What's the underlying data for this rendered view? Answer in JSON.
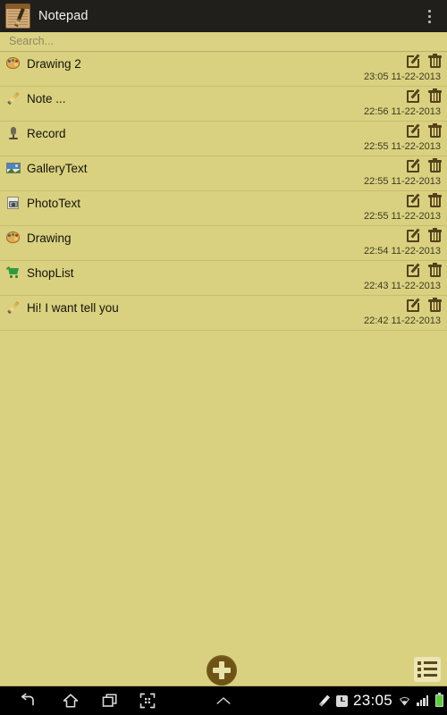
{
  "titlebar": {
    "app_name": "Notepad",
    "app_icon": "notepad-pencil-icon",
    "overflow_icon": "overflow-menu-icon",
    "background": "#211f1c",
    "text_color": "#f2f2ef"
  },
  "search": {
    "placeholder": "Search...",
    "value": ""
  },
  "theme": {
    "page_background": "#d9d17f",
    "row_divider": "#c6bd72",
    "action_icon_color": "#55401c",
    "accent": "#6e5317"
  },
  "notes": [
    {
      "icon": "palette-icon",
      "title": "Drawing 2",
      "date": "23:05 11-22-2013"
    },
    {
      "icon": "pencil-icon",
      "title": "Note ...",
      "date": "22:56 11-22-2013"
    },
    {
      "icon": "mic-icon",
      "title": "Record",
      "date": "22:55 11-22-2013"
    },
    {
      "icon": "gallery-icon",
      "title": "GalleryText",
      "date": "22:55 11-22-2013"
    },
    {
      "icon": "camera-icon",
      "title": "PhotoText",
      "date": "22:55 11-22-2013"
    },
    {
      "icon": "palette-icon",
      "title": "Drawing",
      "date": "22:54 11-22-2013"
    },
    {
      "icon": "cart-icon",
      "title": "ShopList",
      "date": "22:43 11-22-2013"
    },
    {
      "icon": "pencil-icon",
      "title": "Hi! I want tell you",
      "date": "22:42 11-22-2013"
    }
  ],
  "row_actions": {
    "edit_icon": "edit-icon",
    "delete_icon": "trash-icon"
  },
  "bottom_toolbar": {
    "add_icon": "plus-icon",
    "list_icon": "list-view-icon"
  },
  "navbar": {
    "back_icon": "back-arrow-icon",
    "home_icon": "home-icon",
    "recents_icon": "recent-apps-icon",
    "screenshot_icon": "screenshot-icon",
    "caret_icon": "chevron-up-icon",
    "pencil_icon": "pencil-status-icon",
    "alarm_icon": "alarm-icon",
    "clock": "23:05",
    "wifi_icon": "wifi-icon",
    "signal_icon": "signal-icon",
    "battery_icon": "battery-icon"
  }
}
